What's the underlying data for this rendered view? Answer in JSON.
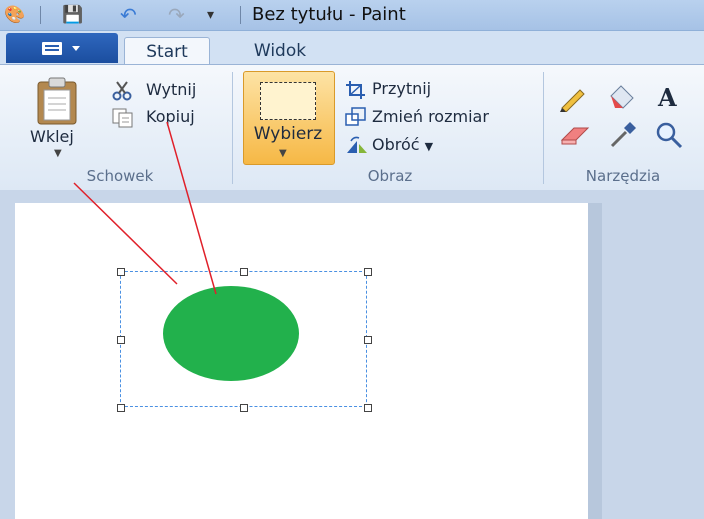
{
  "window": {
    "title": "Bez tytułu - Paint"
  },
  "tabs": [
    {
      "label": "Start",
      "active": true
    },
    {
      "label": "Widok",
      "active": false
    }
  ],
  "clipboard": {
    "group_label": "Schowek",
    "paste_label": "Wklej",
    "cut_label": "Wytnij",
    "copy_label": "Kopiuj"
  },
  "image": {
    "group_label": "Obraz",
    "select_label": "Wybierz",
    "crop_label": "Przytnij",
    "resize_label": "Zmień rozmiar",
    "rotate_label": "Obróć"
  },
  "tools": {
    "group_label": "Narzędzia",
    "icons": [
      "pencil-icon",
      "fill-icon",
      "text-icon",
      "eraser-icon",
      "color-picker-icon",
      "magnifier-icon"
    ]
  },
  "colors": {
    "shape_fill": "#22b14c",
    "selection_border": "#4a90e2",
    "annotation_line": "#e0202a",
    "active_button": "#fbd27a"
  },
  "canvas_content": {
    "shape": "filled-circle",
    "selection": "dashed-rectangle"
  }
}
